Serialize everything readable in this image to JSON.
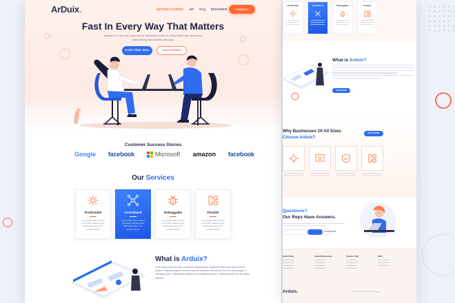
{
  "brand": {
    "logo_main": "ArDuix",
    "logo_dot": "."
  },
  "nav": {
    "items": [
      "GETTING STARTED",
      "API",
      "FAQ",
      "RESOURCE"
    ],
    "contact_label": "CONTACT"
  },
  "hero": {
    "title": "Fast In Every Way That Matters",
    "subtitle": "Dataduix is a free and open source framework based on React that helps developers build blazing fast websites and apps",
    "primary_button": "START FREE TRIAL",
    "secondary_button": "WATCH DEMO"
  },
  "customers": {
    "title": "Customer Success Stories",
    "logos": [
      "Google",
      "facebook",
      "Microsoft",
      "amazon",
      "facebook"
    ]
  },
  "services": {
    "title_main": "Our ",
    "title_accent": "Services",
    "cards": [
      {
        "title": "Predictable",
        "desc": "Lorem ipsum dolor sit amet, consectetur adipiscing elit. Sed feugiat lacus et ex tempus ultricies.",
        "icon": "gear-icon",
        "active": false
      },
      {
        "title": "Centralized",
        "desc": "Lorem ipsum dolor sit amet, consectetur adipiscing elit. Sed feugiat lacus et ex tempus ultricies.",
        "icon": "network-icon",
        "active": true
      },
      {
        "title": "Debuggable",
        "desc": "Lorem ipsum dolor sit amet, consectetur adipiscing elit. Sed feugiat lacus et ex tempus ultricies.",
        "icon": "bug-icon",
        "active": false
      },
      {
        "title": "Flexible",
        "desc": "Lorem ipsum dolor sit amet, consectetur adipiscing elit. Sed feugiat lacus et ex tempus ultricies.",
        "icon": "puzzle-icon",
        "active": false
      }
    ]
  },
  "what": {
    "title_main": "What is ",
    "title_accent": "Arduix?",
    "body": "Lorem ipsum dolor sit amet, consectetur adipiscing elit. Vestibulum fermentum dolor eu risus pulvinar. Phasellus eget leo a lorem maximus commodo sed a purus. Sed eu cursus augue, in venenatis ipsum. Pellentesque habitant morbi tristique senectus. Praesent lobortis dui nec sapien pharetra."
  },
  "right": {
    "cards": [
      {
        "title": "Predictable",
        "icon": "gear-icon",
        "active": false
      },
      {
        "title": "Centralized",
        "icon": "network-icon",
        "active": true
      },
      {
        "title": "Debuggable",
        "icon": "bug-icon",
        "active": false
      },
      {
        "title": "Flexible",
        "icon": "puzzle-icon",
        "active": false
      }
    ],
    "what_title_main": "What is ",
    "what_title_accent": "Arduix?",
    "learn_more": "LEARN MORE",
    "why_title_line1": "Why Businesses Of All Sizes",
    "why_title_line2_accent": "Choose Arduix?",
    "why_button": "GET STARTED",
    "questions_accent": "Questions?",
    "questions_line2": "Our Reps Have Answers.",
    "questions_link": "LEARN MORE",
    "footer_cols": [
      "Useful Links",
      "General Resources",
      "Popular Links",
      "More"
    ],
    "footer_logo": "Arduix."
  },
  "colors": {
    "accent_blue": "#2f6cf0",
    "accent_orange": "#ff6a33",
    "text_dark": "#1d2540"
  }
}
